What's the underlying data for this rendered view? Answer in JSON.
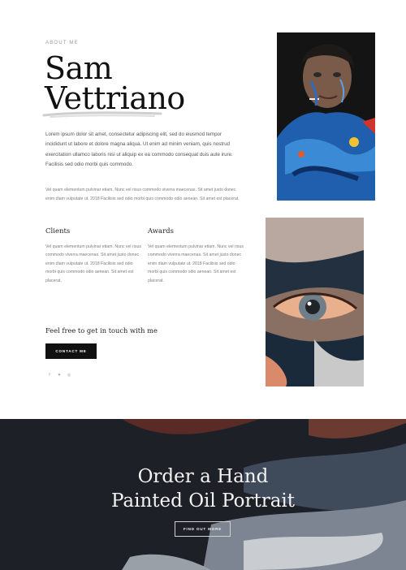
{
  "about": {
    "eyebrow": "ABOUT ME",
    "name_line1": "Sam",
    "name_line2": "Vettriano",
    "lead": "Lorem ipsum dolor sit amet, consectetur adipiscing elit, sed do eiusmod tempor incididunt ut labore et dolore magna aliqua. Ut enim ad minim veniam, quis nostrud exercitation ullamco laboris nisi ut aliquip ex ea commodo consequat duis aute irure. Facilisis sed odio morbi quis commodo.",
    "small": "Vel quam elementum pulvinar etiam. Nunc vel risus commodo viverra maecenas. Sit amet justo donec enim diam vulputate ut. 2018 Facilisis sed odio morbi quis commodo odio aenean. Sit amet est placerat."
  },
  "columns": [
    {
      "title": "Clients",
      "text": "Vel quam elementum pulvinar etiam. Nunc vel risus commodo viverra maecenas. Sit amet justo donec enim diam vulputate ut. 2018 Facilisis sed odio morbi quis commodo odio aenean. Sit amet est placerat."
    },
    {
      "title": "Awards",
      "text": "Vel quam elementum pulvinar etiam. Nunc vel risus commodo viverra maecenas. Sit amet justo donec enim diam vulputate ut. 2018 Facilisis sed odio morbi quis commodo odio aenean. Sit amet est placerat."
    }
  ],
  "contact": {
    "prompt": "Feel free to get in touch with me",
    "button": "CONTACT ME"
  },
  "social": [
    {
      "glyph": "f",
      "icon": "facebook-icon"
    },
    {
      "glyph": "♥",
      "icon": "twitter-icon"
    },
    {
      "glyph": "◎",
      "icon": "instagram-icon"
    }
  ],
  "cta": {
    "title_line1": "Order a Hand",
    "title_line2": "Painted Oil Portrait",
    "button": "FIND OUT MORE"
  },
  "colors": {
    "accent": "#111111",
    "footer_bg": "#1d2027",
    "paint_blue": "#1f5fae"
  }
}
